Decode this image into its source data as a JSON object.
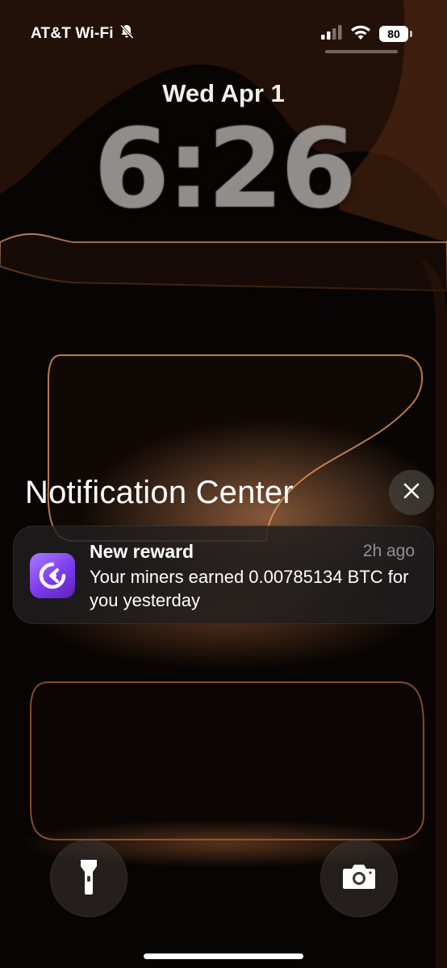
{
  "status_bar": {
    "carrier": "AT&T Wi-Fi",
    "silent_icon": "bell-slash-icon",
    "signal_icon": "cellular-signal-icon",
    "wifi_icon": "wifi-icon",
    "battery_percent": "80"
  },
  "lock_screen": {
    "date": "Wed Apr 1",
    "time": "6:26"
  },
  "notification_center": {
    "title": "Notification Center",
    "close_icon": "close-icon"
  },
  "notifications": [
    {
      "app_icon": "app-logo-icon",
      "title": "New reward",
      "time": "2h ago",
      "body": "Your miners earned 0.00785134 BTC for you yesterday"
    }
  ],
  "quick_actions": {
    "left_icon": "flashlight-icon",
    "right_icon": "camera-icon"
  },
  "colors": {
    "wallpaper_glow": "#c87a45",
    "app_icon_purple": "#7c3aed"
  }
}
